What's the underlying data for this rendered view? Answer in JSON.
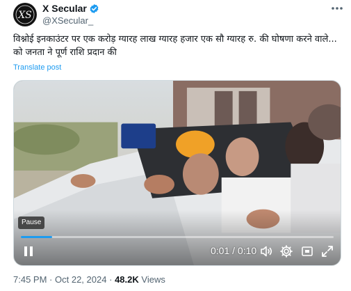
{
  "author": {
    "display_name": "X Secular",
    "handle": "@XSecular_",
    "avatar_icon": "xs-monogram-logo",
    "avatar_text": "XS",
    "verified_icon": "verified-badge-icon",
    "verified_color": "#1d9bf0"
  },
  "more_icon": "more-options-icon",
  "tweet": {
    "text": "विश्नोई इनकाउंटर पर एक करोड़ ग्यारह लाख ग्यारह हजार एक सौ ग्यारह रु. की घोषणा करने वाले... को जनता ने पूर्ण राशि प्रदान की",
    "translate_label": "Translate post"
  },
  "video": {
    "tooltip": "Pause",
    "current_time": "0:01",
    "duration": "0:10",
    "time_separator": " / ",
    "progress": 0.1,
    "progress_color": "#1d9bf0",
    "controls": [
      "pause-icon",
      "volume-icon",
      "settings-gear-icon",
      "fullscreen-icon",
      "expand-icon"
    ]
  },
  "footer": {
    "time": "7:45 PM",
    "date": "Oct 22, 2024",
    "separator": "·",
    "views_count": "48.2K",
    "views_label": "Views"
  },
  "colors": {
    "accent": "#1d9bf0",
    "text_primary": "#0f1419",
    "text_secondary": "#536471"
  }
}
